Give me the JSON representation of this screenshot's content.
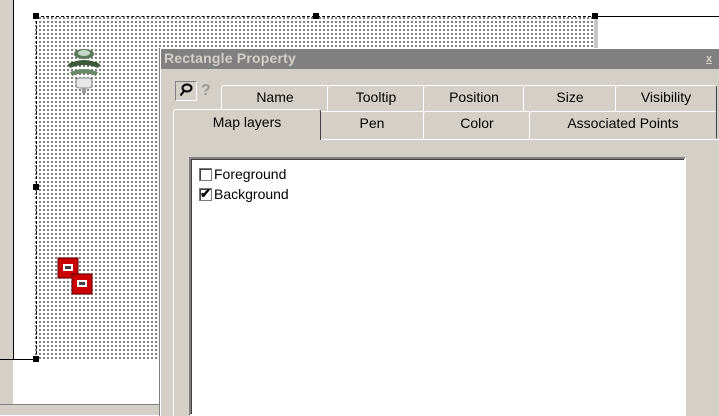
{
  "dialog": {
    "title": "Rectangle Property",
    "close_label": "x",
    "help_label": "?",
    "tabs_row1": [
      "Name",
      "Tooltip",
      "Position",
      "Size",
      "Visibility"
    ],
    "tabs_row2": [
      "Map layers",
      "Pen",
      "Color",
      "Associated Points"
    ],
    "active_tab": "Map layers"
  },
  "layers": [
    {
      "label": "Foreground",
      "checked": false,
      "mark": ""
    },
    {
      "label": "Background",
      "checked": true,
      "mark": "✔"
    }
  ],
  "icons": {
    "pin": "pushpin-icon",
    "help": "help-icon",
    "sprinkler": "sprinkler-icon",
    "alarm": "fire-alarm-icon"
  },
  "colors": {
    "titlebar": "#808080",
    "dialog_bg": "#d4d0c8",
    "alarm_red": "#cc0000"
  }
}
